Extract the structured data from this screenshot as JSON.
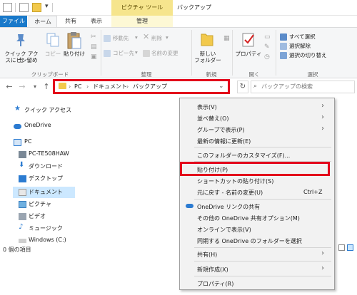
{
  "titlebar": {
    "contextual_tab": "ピクチャ ツール",
    "title": "バックアップ"
  },
  "tabs": {
    "file": "ファイル",
    "home": "ホーム",
    "share": "共有",
    "view": "表示",
    "manage": "管理"
  },
  "ribbon": {
    "quick_access_line1": "クイック アクセ",
    "quick_access_line2": "スにピン留め",
    "copy": "コピー",
    "paste": "貼り付け",
    "clipboard_group": "クリップボード",
    "move_to": "移動先",
    "copy_to": "コピー先",
    "delete": "削除",
    "rename": "名前の変更",
    "organize_group": "整理",
    "new_folder_line1": "新しい",
    "new_folder_line2": "フォルダー",
    "new_group": "新規",
    "properties": "プロパティ",
    "open_group": "開く",
    "select_all": "すべて選択",
    "select_none": "選択解除",
    "invert_selection": "選択の切り替え",
    "select_group": "選択"
  },
  "address": {
    "crumbs": [
      "PC",
      "ドキュメント",
      "バックアップ"
    ],
    "search_placeholder": "バックアップの検索"
  },
  "navpane": {
    "items": [
      "クイック アクセス",
      "OneDrive",
      "PC",
      "PC-TE508HAW",
      "ダウンロード",
      "デスクトップ",
      "ドキュメント",
      "ピクチャ",
      "ビデオ",
      "ミュージック",
      "Windows (C:)"
    ]
  },
  "status": {
    "count": "0 個の項目"
  },
  "context_menu": {
    "view": "表示(V)",
    "sort_by": "並べ替え(O)",
    "group_by": "グループで表示(P)",
    "refresh": "最新の情報に更新(E)",
    "customize": "このフォルダーのカスタマイズ(F)...",
    "paste": "貼り付け(P)",
    "paste_shortcut": "ショートカットの貼り付け(S)",
    "undo_rename": "元に戻す - 名前の変更(U)",
    "undo_shortcut": "Ctrl+Z",
    "onedrive_share": "OneDrive リンクの共有",
    "onedrive_other": "その他の OneDrive 共有オプション(M)",
    "view_online": "オンラインで表示(V)",
    "sync_folder": "同期する OneDrive のフォルダーを選択",
    "share": "共有(H)",
    "new": "新規作成(X)",
    "properties": "プロパティ(R)"
  },
  "colors": {
    "accent": "#1979ca",
    "highlight_red": "#e3001b",
    "contextual_yellow": "#f6e58d",
    "selected": "#cce8ff"
  }
}
